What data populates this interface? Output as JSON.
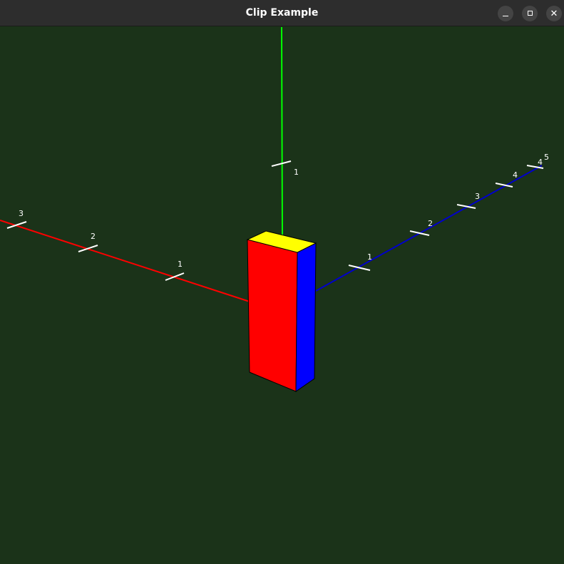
{
  "window": {
    "title": "Clip Example",
    "minimize_icon": "minimize-icon",
    "maximize_icon": "maximize-icon",
    "close_icon": "close-icon"
  },
  "scene": {
    "background": "#1b3319",
    "axes": {
      "x": {
        "color": "#ff0000",
        "tick_labels": [
          "1",
          "2",
          "3"
        ]
      },
      "y": {
        "color": "#00ff00",
        "tick_labels": [
          "1"
        ]
      },
      "z": {
        "color": "#0000cc",
        "tick_labels": [
          "1",
          "2",
          "3",
          "4",
          "5"
        ]
      }
    },
    "box_faces": {
      "front": "#ff0000",
      "side": "#0000ff",
      "top": "#ffff00"
    }
  }
}
